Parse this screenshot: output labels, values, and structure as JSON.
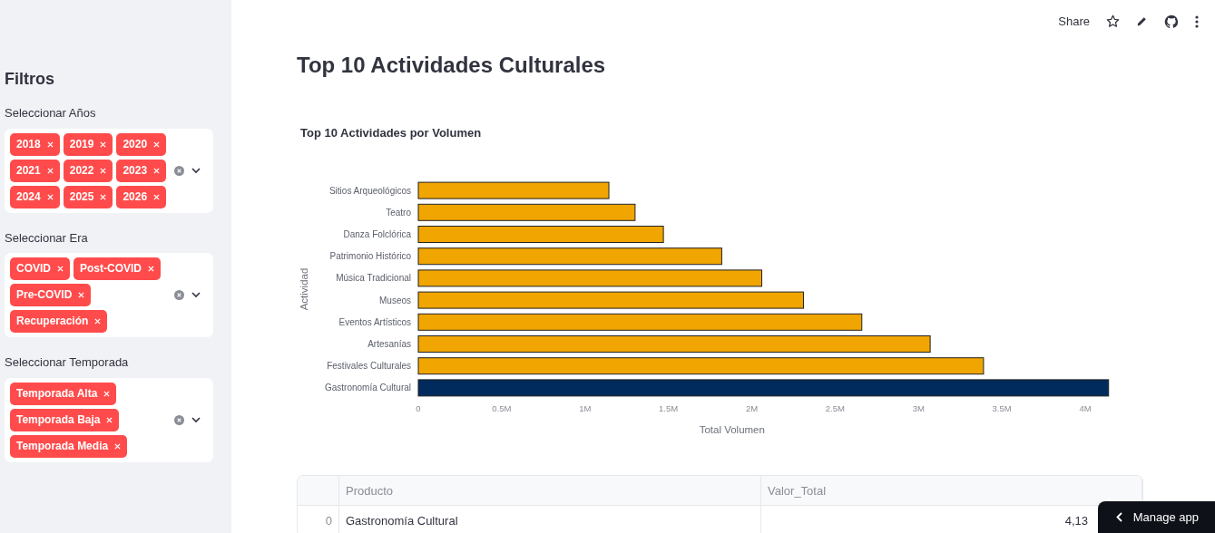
{
  "header": {
    "share": "Share"
  },
  "sidebar": {
    "title": "Filtros",
    "filters": [
      {
        "label": "Seleccionar Años",
        "tags": [
          "2018",
          "2019",
          "2020",
          "2021",
          "2022",
          "2023",
          "2024",
          "2025",
          "2026"
        ]
      },
      {
        "label": "Seleccionar Era",
        "tags": [
          "COVID",
          "Post-COVID",
          "Pre-COVID",
          "Recuperación"
        ]
      },
      {
        "label": "Seleccionar Temporada",
        "tags": [
          "Temporada Alta",
          "Temporada Baja",
          "Temporada Media"
        ]
      }
    ]
  },
  "main": {
    "title": "Top 10 Actividades Culturales",
    "chart": {
      "chart_data": {
        "type": "bar",
        "orientation": "horizontal",
        "stacked": true,
        "title": "Top 10 Actividades por Volumen",
        "xlabel": "Total Volumen",
        "ylabel": "Actividad",
        "categories": [
          "Sitios Arqueológicos",
          "Teatro",
          "Danza Folclórica",
          "Patrimonio Histórico",
          "Música Tradicional",
          "Museos",
          "Eventos Artísticos",
          "Artesanías",
          "Festivales Culturales",
          "Gastronomía Cultural"
        ],
        "series": [
          {
            "color": "#f0a500",
            "values": [
              1143000,
              1300000,
              1470000,
              1820000,
              2060000,
              2310000,
              2660000,
              3070000,
              3390000,
              null
            ]
          },
          {
            "color": "#002b5c",
            "values": [
              null,
              null,
              null,
              null,
              null,
              null,
              null,
              null,
              null,
              4140000
            ]
          }
        ],
        "xlim": [
          0,
          4140000
        ],
        "xticks": [
          {
            "value": 0,
            "label": "0"
          },
          {
            "value": 500000,
            "label": "0.5M"
          },
          {
            "value": 1000000,
            "label": "1M"
          },
          {
            "value": 1500000,
            "label": "1.5M"
          },
          {
            "value": 2000000,
            "label": "2M"
          },
          {
            "value": 2500000,
            "label": "2.5M"
          },
          {
            "value": 3000000,
            "label": "3M"
          },
          {
            "value": 3500000,
            "label": "3.5M"
          },
          {
            "value": 4000000,
            "label": "4M"
          }
        ]
      }
    },
    "table": {
      "columns": [
        "Producto",
        "Valor_Total"
      ],
      "rows": [
        {
          "index": "0",
          "producto": "Gastronomía Cultural",
          "valor": "4,13"
        }
      ]
    }
  },
  "manage_app": "Manage app"
}
